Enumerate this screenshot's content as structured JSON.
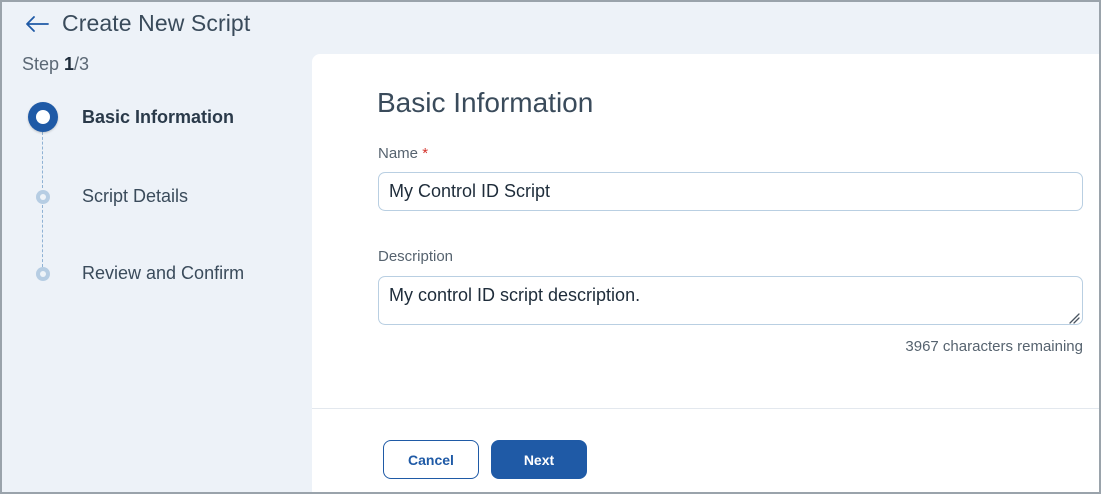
{
  "header": {
    "back_icon": "arrow-left-icon",
    "title": "Create New Script"
  },
  "step_indicator": {
    "prefix": "Step ",
    "current": "1",
    "total": "/3"
  },
  "stepper": {
    "steps": [
      {
        "label": "Basic Information",
        "state": "active"
      },
      {
        "label": "Script Details",
        "state": "pending"
      },
      {
        "label": "Review and Confirm",
        "state": "pending"
      }
    ]
  },
  "form": {
    "section_title": "Basic Information",
    "name": {
      "label": "Name",
      "required_mark": "*",
      "value": "My Control ID Script"
    },
    "description": {
      "label": "Description",
      "value": "My control ID script description.",
      "remaining_text": "3967 characters remaining"
    }
  },
  "actions": {
    "cancel_label": "Cancel",
    "next_label": "Next"
  },
  "colors": {
    "accent": "#1f5aa6",
    "background": "#edf2f8",
    "required": "#d3322b"
  }
}
